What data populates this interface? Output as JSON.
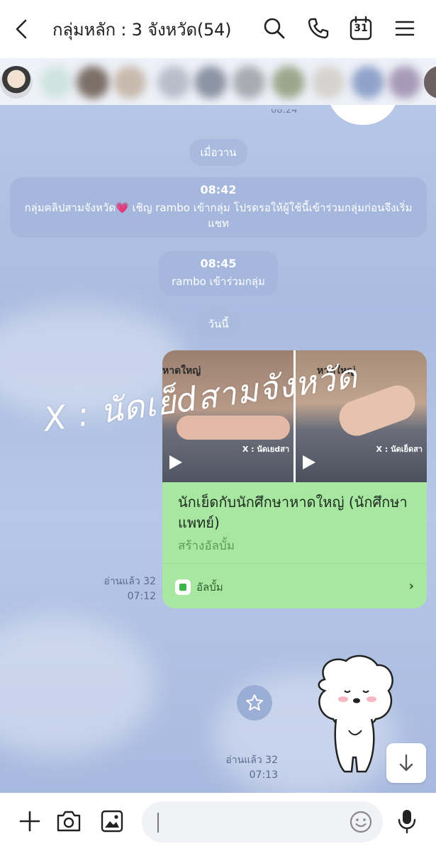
{
  "header": {
    "title": "กลุ่มหลัก : 3 จังหวัด(54)",
    "calendar_day": "31"
  },
  "chat": {
    "top_time_partial": "08:24",
    "date_yesterday": "เมื่อวาน",
    "system_1": {
      "time": "08:42",
      "message": "กลุ่มคลิปสามจังหวัด💗 เชิญ rambo เข้ากลุ่ม โปรดรอให้ผู้ใช้นี้เข้าร่วมกลุ่มก่อนจึงเริ่มแชท"
    },
    "system_2": {
      "time": "08:45",
      "message": "rambo เข้าร่วมกลุ่ม"
    },
    "date_today": "วันนี้",
    "album": {
      "thumb_1_caption": "หาดใหญ่",
      "thumb_1_watermark": "X : นัดเยdสา",
      "thumb_2_caption": "หาดใหญ่",
      "thumb_2_watermark": "X : นัดเย็ดสา",
      "title": "นักเย็ดกับนักศึกษาหาดใหญ่ (นักศึกษาแพทย์)",
      "subtitle": "สร้างอัลบั้ม",
      "footer_label": "อัลบั้ม"
    },
    "read_1": {
      "label": "อ่านแล้ว 32",
      "time": "07:12"
    },
    "read_2": {
      "label": "อ่านแล้ว 32",
      "time": "07:13"
    },
    "overlay_text": "X : นัดเย็dสามจังหวัด"
  },
  "colors": {
    "album_green": "#a7e7a2",
    "chat_bg": "#aebfe2",
    "system_pill": "#a4b6db"
  }
}
